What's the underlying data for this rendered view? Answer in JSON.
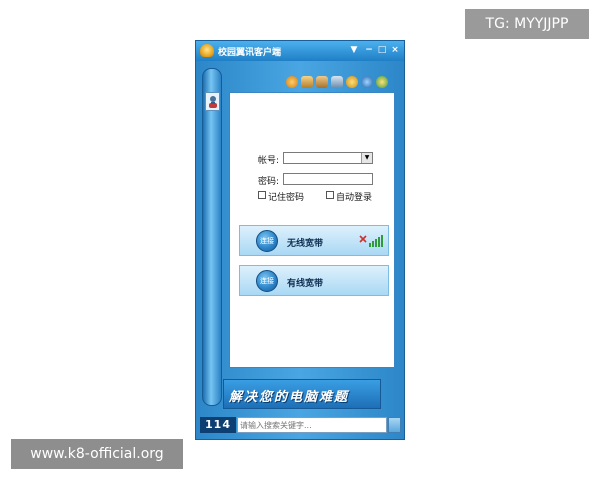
{
  "watermarks": {
    "top_right": "TG: MYYJJPP",
    "bottom_left": "www.k8-official.org"
  },
  "window": {
    "title": "校园翼讯客户端",
    "title_buttons": {
      "menu": "▼",
      "minimize": "−",
      "maximize": "□",
      "close": "×"
    }
  },
  "toolbar": {
    "icons": [
      "orange-circle-icon",
      "users-icon",
      "users-2-icon",
      "computer-icon",
      "smiley-icon",
      "globe-icon",
      "chat-icon"
    ]
  },
  "login": {
    "account_label": "帐号:",
    "account_value": "",
    "password_label": "密码:",
    "password_value": "",
    "remember_label": "记住密码",
    "auto_login_label": "自动登录",
    "remember_checked": false,
    "auto_login_checked": false
  },
  "connections": [
    {
      "button_label": "连接",
      "name": "无线宽带",
      "signal": true
    },
    {
      "button_label": "连接",
      "name": "有线宽带",
      "signal": false
    }
  ],
  "banner": {
    "text": "解决您的电脑难题"
  },
  "search": {
    "logo": "114",
    "placeholder": "请输入搜索关键字..."
  },
  "colors": {
    "accent": "#2c86c8",
    "titlebar": "#1f7fc6",
    "panel_bg": "#ffffff"
  }
}
